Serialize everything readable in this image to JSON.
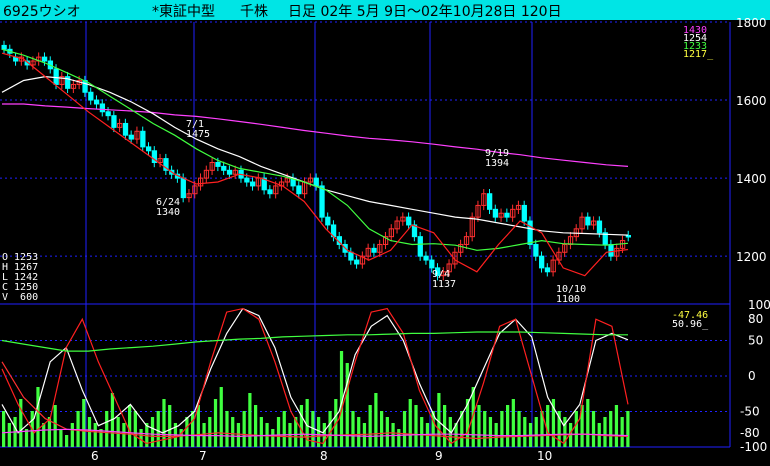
{
  "header": {
    "code_name": "6925ウシオ",
    "market": "*東証中型",
    "unit": "千株",
    "period": "日足 02年 5月 9日～02年10月28日 120日"
  },
  "ohlcv": {
    "open": "O 1253",
    "high": "H 1267",
    "low": "L 1242",
    "close": "C 1250",
    "volume": "V  600"
  },
  "legend_top": [
    {
      "text": "1430",
      "color": "#ff40ff"
    },
    {
      "text": "1254",
      "color": "#ffffff"
    },
    {
      "text": "1233",
      "color": "#40ff40"
    },
    {
      "text": "1217_",
      "color": "#ffff40"
    }
  ],
  "legend_bottom": [
    {
      "text": "-47.46",
      "color": "#ffff40"
    },
    {
      "text": "50.96_",
      "color": "#ffffff"
    }
  ],
  "colors": {
    "background": "#000000",
    "header": "#00e5e5",
    "grid": "#2020ff",
    "candle_up": "#ff3030",
    "candle_down": "#00ffff",
    "ma_long": "#ff40ff",
    "ma_mid": "#ffffff",
    "ma_short": "#40ff40",
    "ma_fast": "#ff2020",
    "volume": "#40ff40"
  },
  "chart_data": [
    {
      "type": "line",
      "title": "",
      "x_tick_labels": [
        "6",
        "7",
        "8",
        "9",
        "10"
      ],
      "y_tick_labels": [
        "1800",
        "1600",
        "1400",
        "1200"
      ],
      "ylim": [
        1080,
        1800
      ],
      "grid": true,
      "annotations": [
        {
          "text": [
            "7/1",
            "1475"
          ],
          "label": "7/1 high"
        },
        {
          "text": [
            "6/24",
            "1340"
          ],
          "label": "6/24 low"
        },
        {
          "text": [
            "9/19",
            "1394"
          ],
          "label": "9/19 high"
        },
        {
          "text": [
            "9/4",
            "1137"
          ],
          "label": "9/4 low"
        },
        {
          "text": [
            "10/10",
            "1100"
          ],
          "label": "10/10 low"
        }
      ],
      "candles_close": [
        1730,
        1720,
        1700,
        1710,
        1690,
        1700,
        1710,
        1700,
        1680,
        1640,
        1660,
        1630,
        1640,
        1650,
        1620,
        1600,
        1590,
        1570,
        1560,
        1530,
        1540,
        1510,
        1500,
        1520,
        1480,
        1470,
        1440,
        1450,
        1420,
        1410,
        1400,
        1350,
        1360,
        1380,
        1400,
        1420,
        1440,
        1430,
        1420,
        1410,
        1420,
        1400,
        1390,
        1380,
        1400,
        1370,
        1360,
        1380,
        1390,
        1400,
        1380,
        1360,
        1390,
        1400,
        1380,
        1300,
        1280,
        1250,
        1230,
        1210,
        1190,
        1180,
        1200,
        1220,
        1210,
        1230,
        1250,
        1270,
        1290,
        1300,
        1280,
        1250,
        1200,
        1190,
        1170,
        1150,
        1160,
        1180,
        1210,
        1230,
        1250,
        1300,
        1330,
        1360,
        1320,
        1300,
        1310,
        1300,
        1320,
        1330,
        1290,
        1230,
        1200,
        1170,
        1160,
        1190,
        1210,
        1230,
        1250,
        1270,
        1300,
        1280,
        1290,
        1260,
        1230,
        1200,
        1220,
        1240,
        1250
      ],
      "candles_open": [
        1740,
        1730,
        1710,
        1700,
        1700,
        1690,
        1700,
        1710,
        1700,
        1680,
        1640,
        1660,
        1630,
        1640,
        1650,
        1620,
        1600,
        1590,
        1570,
        1560,
        1530,
        1540,
        1510,
        1500,
        1520,
        1480,
        1470,
        1440,
        1450,
        1420,
        1410,
        1400,
        1350,
        1360,
        1380,
        1400,
        1420,
        1440,
        1430,
        1420,
        1410,
        1420,
        1400,
        1390,
        1380,
        1400,
        1370,
        1360,
        1380,
        1390,
        1400,
        1380,
        1360,
        1390,
        1400,
        1380,
        1300,
        1280,
        1250,
        1230,
        1210,
        1190,
        1180,
        1200,
        1220,
        1210,
        1230,
        1250,
        1270,
        1290,
        1300,
        1280,
        1250,
        1200,
        1190,
        1170,
        1150,
        1160,
        1180,
        1210,
        1230,
        1250,
        1300,
        1330,
        1360,
        1320,
        1300,
        1310,
        1300,
        1320,
        1330,
        1290,
        1230,
        1200,
        1170,
        1160,
        1190,
        1210,
        1230,
        1250,
        1270,
        1300,
        1280,
        1290,
        1260,
        1230,
        1200,
        1220,
        1253
      ],
      "series": [
        {
          "color_key": "ma_long",
          "values": [
            1590,
            1590,
            1585,
            1582,
            1578,
            1575,
            1572,
            1568,
            1562,
            1558,
            1552,
            1545,
            1538,
            1530,
            1522,
            1515,
            1508,
            1502,
            1498,
            1493,
            1487,
            1480,
            1474,
            1466,
            1460,
            1452,
            1446,
            1440,
            1434,
            1430
          ]
        },
        {
          "color_key": "ma_mid",
          "values": [
            1620,
            1650,
            1660,
            1655,
            1640,
            1620,
            1595,
            1565,
            1530,
            1500,
            1475,
            1455,
            1430,
            1410,
            1390,
            1370,
            1355,
            1340,
            1330,
            1320,
            1310,
            1300,
            1295,
            1285,
            1275,
            1265,
            1260,
            1258,
            1256,
            1254
          ]
        },
        {
          "color_key": "ma_short",
          "values": [
            1730,
            1715,
            1695,
            1670,
            1645,
            1610,
            1575,
            1540,
            1510,
            1475,
            1445,
            1425,
            1415,
            1405,
            1390,
            1370,
            1330,
            1270,
            1240,
            1230,
            1232,
            1228,
            1215,
            1220,
            1230,
            1240,
            1232,
            1230,
            1228,
            1233
          ]
        },
        {
          "color_key": "ma_fast",
          "values": [
            1720,
            1705,
            1660,
            1615,
            1570,
            1530,
            1490,
            1450,
            1410,
            1385,
            1390,
            1410,
            1400,
            1380,
            1340,
            1270,
            1215,
            1190,
            1215,
            1280,
            1260,
            1190,
            1160,
            1230,
            1290,
            1260,
            1170,
            1150,
            1210,
            1217
          ]
        }
      ]
    },
    {
      "type": "line",
      "title": "",
      "y_tick_labels": [
        "100",
        "80",
        "50",
        "0",
        "-50",
        "-80",
        "-100"
      ],
      "ylim": [
        -100,
        100
      ],
      "series": [
        {
          "color_key": "ma_mid",
          "values": [
            -40,
            -80,
            -60,
            20,
            40,
            -20,
            -70,
            -60,
            -40,
            -70,
            -80,
            -70,
            -50,
            10,
            60,
            95,
            85,
            40,
            -30,
            -70,
            -80,
            -50,
            30,
            70,
            85,
            50,
            -10,
            -60,
            -80,
            -40,
            10,
            60,
            80,
            55,
            -30,
            -70,
            -40,
            50,
            60,
            51
          ]
        },
        {
          "color_key": "ma_fast",
          "values": [
            10,
            -40,
            -80,
            -60,
            40,
            80,
            20,
            -30,
            -80,
            -95,
            -90,
            -85,
            -60,
            20,
            90,
            95,
            80,
            20,
            -50,
            -90,
            -95,
            -60,
            20,
            90,
            95,
            60,
            -20,
            -70,
            -95,
            -80,
            -10,
            70,
            80,
            0,
            -80,
            -95,
            -60,
            80,
            70,
            -40
          ]
        },
        {
          "color_key": "ma_short",
          "values": [
            50,
            45,
            40,
            35,
            35,
            38,
            40,
            42,
            45,
            48,
            50,
            52,
            53,
            55,
            56,
            57,
            58,
            58,
            59,
            60,
            60,
            61,
            62,
            62,
            62,
            61,
            60,
            59,
            58,
            58
          ]
        },
        {
          "color_key": "candle_up",
          "values": [
            20,
            -30,
            -60,
            -75,
            -78,
            -80,
            -82,
            -85,
            -85,
            -83,
            -80,
            -82,
            -84,
            -85,
            -86,
            -84,
            -83,
            -82,
            -80,
            -82,
            -84,
            -86,
            -88,
            -86,
            -85,
            -84,
            -83,
            -82,
            -84,
            -85
          ]
        },
        {
          "color_key": "ma_long",
          "values": [
            -80,
            -78,
            -76,
            -75,
            -76,
            -78,
            -80,
            -82,
            -83,
            -84,
            -84,
            -85,
            -84,
            -83,
            -82,
            -83,
            -84,
            -85,
            -84,
            -83,
            -82,
            -82,
            -83,
            -84,
            -84,
            -83,
            -82,
            -82,
            -83,
            -84
          ]
        }
      ],
      "volume": [
        30,
        20,
        25,
        40,
        15,
        30,
        50,
        20,
        25,
        35,
        15,
        10,
        20,
        30,
        40,
        25,
        20,
        15,
        30,
        45,
        25,
        20,
        35,
        30,
        15,
        20,
        25,
        30,
        40,
        35,
        20,
        15,
        25,
        30,
        35,
        20,
        25,
        40,
        50,
        30,
        25,
        20,
        30,
        45,
        35,
        25,
        20,
        15,
        25,
        30,
        20,
        25,
        35,
        40,
        30,
        25,
        20,
        30,
        40,
        80,
        70,
        30,
        25,
        20,
        35,
        45,
        30,
        25,
        20,
        15,
        30,
        40,
        35,
        25,
        20,
        30,
        45,
        35,
        25,
        20,
        30,
        40,
        50,
        35,
        30,
        25,
        20,
        30,
        35,
        40,
        30,
        25,
        20,
        25,
        30,
        35,
        40,
        30,
        25,
        20,
        30,
        35,
        40,
        30,
        20,
        25,
        30,
        35,
        25,
        30
      ]
    }
  ]
}
